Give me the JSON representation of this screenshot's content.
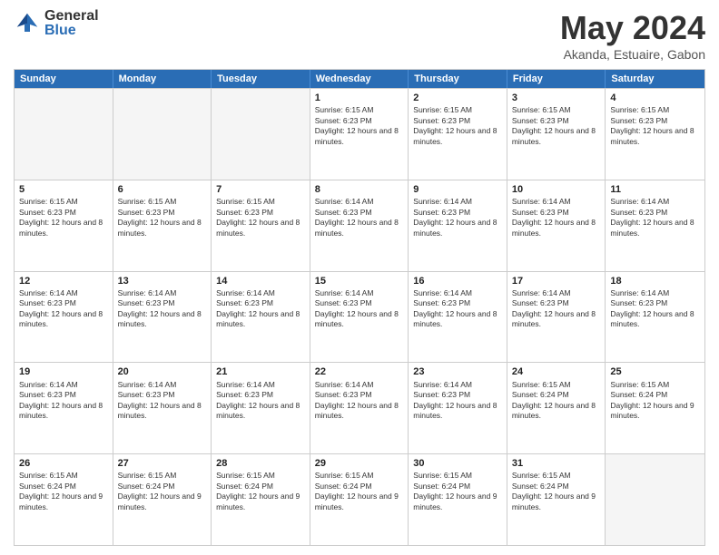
{
  "header": {
    "logo_general": "General",
    "logo_blue": "Blue",
    "month_title": "May 2024",
    "location": "Akanda, Estuaire, Gabon"
  },
  "days_of_week": [
    "Sunday",
    "Monday",
    "Tuesday",
    "Wednesday",
    "Thursday",
    "Friday",
    "Saturday"
  ],
  "rows": [
    [
      {
        "day": "",
        "empty": true
      },
      {
        "day": "",
        "empty": true
      },
      {
        "day": "",
        "empty": true
      },
      {
        "day": "1",
        "sunrise": "Sunrise: 6:15 AM",
        "sunset": "Sunset: 6:23 PM",
        "daylight": "Daylight: 12 hours and 8 minutes."
      },
      {
        "day": "2",
        "sunrise": "Sunrise: 6:15 AM",
        "sunset": "Sunset: 6:23 PM",
        "daylight": "Daylight: 12 hours and 8 minutes."
      },
      {
        "day": "3",
        "sunrise": "Sunrise: 6:15 AM",
        "sunset": "Sunset: 6:23 PM",
        "daylight": "Daylight: 12 hours and 8 minutes."
      },
      {
        "day": "4",
        "sunrise": "Sunrise: 6:15 AM",
        "sunset": "Sunset: 6:23 PM",
        "daylight": "Daylight: 12 hours and 8 minutes."
      }
    ],
    [
      {
        "day": "5",
        "sunrise": "Sunrise: 6:15 AM",
        "sunset": "Sunset: 6:23 PM",
        "daylight": "Daylight: 12 hours and 8 minutes."
      },
      {
        "day": "6",
        "sunrise": "Sunrise: 6:15 AM",
        "sunset": "Sunset: 6:23 PM",
        "daylight": "Daylight: 12 hours and 8 minutes."
      },
      {
        "day": "7",
        "sunrise": "Sunrise: 6:15 AM",
        "sunset": "Sunset: 6:23 PM",
        "daylight": "Daylight: 12 hours and 8 minutes."
      },
      {
        "day": "8",
        "sunrise": "Sunrise: 6:14 AM",
        "sunset": "Sunset: 6:23 PM",
        "daylight": "Daylight: 12 hours and 8 minutes."
      },
      {
        "day": "9",
        "sunrise": "Sunrise: 6:14 AM",
        "sunset": "Sunset: 6:23 PM",
        "daylight": "Daylight: 12 hours and 8 minutes."
      },
      {
        "day": "10",
        "sunrise": "Sunrise: 6:14 AM",
        "sunset": "Sunset: 6:23 PM",
        "daylight": "Daylight: 12 hours and 8 minutes."
      },
      {
        "day": "11",
        "sunrise": "Sunrise: 6:14 AM",
        "sunset": "Sunset: 6:23 PM",
        "daylight": "Daylight: 12 hours and 8 minutes."
      }
    ],
    [
      {
        "day": "12",
        "sunrise": "Sunrise: 6:14 AM",
        "sunset": "Sunset: 6:23 PM",
        "daylight": "Daylight: 12 hours and 8 minutes."
      },
      {
        "day": "13",
        "sunrise": "Sunrise: 6:14 AM",
        "sunset": "Sunset: 6:23 PM",
        "daylight": "Daylight: 12 hours and 8 minutes."
      },
      {
        "day": "14",
        "sunrise": "Sunrise: 6:14 AM",
        "sunset": "Sunset: 6:23 PM",
        "daylight": "Daylight: 12 hours and 8 minutes."
      },
      {
        "day": "15",
        "sunrise": "Sunrise: 6:14 AM",
        "sunset": "Sunset: 6:23 PM",
        "daylight": "Daylight: 12 hours and 8 minutes."
      },
      {
        "day": "16",
        "sunrise": "Sunrise: 6:14 AM",
        "sunset": "Sunset: 6:23 PM",
        "daylight": "Daylight: 12 hours and 8 minutes."
      },
      {
        "day": "17",
        "sunrise": "Sunrise: 6:14 AM",
        "sunset": "Sunset: 6:23 PM",
        "daylight": "Daylight: 12 hours and 8 minutes."
      },
      {
        "day": "18",
        "sunrise": "Sunrise: 6:14 AM",
        "sunset": "Sunset: 6:23 PM",
        "daylight": "Daylight: 12 hours and 8 minutes."
      }
    ],
    [
      {
        "day": "19",
        "sunrise": "Sunrise: 6:14 AM",
        "sunset": "Sunset: 6:23 PM",
        "daylight": "Daylight: 12 hours and 8 minutes."
      },
      {
        "day": "20",
        "sunrise": "Sunrise: 6:14 AM",
        "sunset": "Sunset: 6:23 PM",
        "daylight": "Daylight: 12 hours and 8 minutes."
      },
      {
        "day": "21",
        "sunrise": "Sunrise: 6:14 AM",
        "sunset": "Sunset: 6:23 PM",
        "daylight": "Daylight: 12 hours and 8 minutes."
      },
      {
        "day": "22",
        "sunrise": "Sunrise: 6:14 AM",
        "sunset": "Sunset: 6:23 PM",
        "daylight": "Daylight: 12 hours and 8 minutes."
      },
      {
        "day": "23",
        "sunrise": "Sunrise: 6:14 AM",
        "sunset": "Sunset: 6:23 PM",
        "daylight": "Daylight: 12 hours and 8 minutes."
      },
      {
        "day": "24",
        "sunrise": "Sunrise: 6:15 AM",
        "sunset": "Sunset: 6:24 PM",
        "daylight": "Daylight: 12 hours and 8 minutes."
      },
      {
        "day": "25",
        "sunrise": "Sunrise: 6:15 AM",
        "sunset": "Sunset: 6:24 PM",
        "daylight": "Daylight: 12 hours and 9 minutes."
      }
    ],
    [
      {
        "day": "26",
        "sunrise": "Sunrise: 6:15 AM",
        "sunset": "Sunset: 6:24 PM",
        "daylight": "Daylight: 12 hours and 9 minutes."
      },
      {
        "day": "27",
        "sunrise": "Sunrise: 6:15 AM",
        "sunset": "Sunset: 6:24 PM",
        "daylight": "Daylight: 12 hours and 9 minutes."
      },
      {
        "day": "28",
        "sunrise": "Sunrise: 6:15 AM",
        "sunset": "Sunset: 6:24 PM",
        "daylight": "Daylight: 12 hours and 9 minutes."
      },
      {
        "day": "29",
        "sunrise": "Sunrise: 6:15 AM",
        "sunset": "Sunset: 6:24 PM",
        "daylight": "Daylight: 12 hours and 9 minutes."
      },
      {
        "day": "30",
        "sunrise": "Sunrise: 6:15 AM",
        "sunset": "Sunset: 6:24 PM",
        "daylight": "Daylight: 12 hours and 9 minutes."
      },
      {
        "day": "31",
        "sunrise": "Sunrise: 6:15 AM",
        "sunset": "Sunset: 6:24 PM",
        "daylight": "Daylight: 12 hours and 9 minutes."
      },
      {
        "day": "",
        "empty": true
      }
    ]
  ]
}
